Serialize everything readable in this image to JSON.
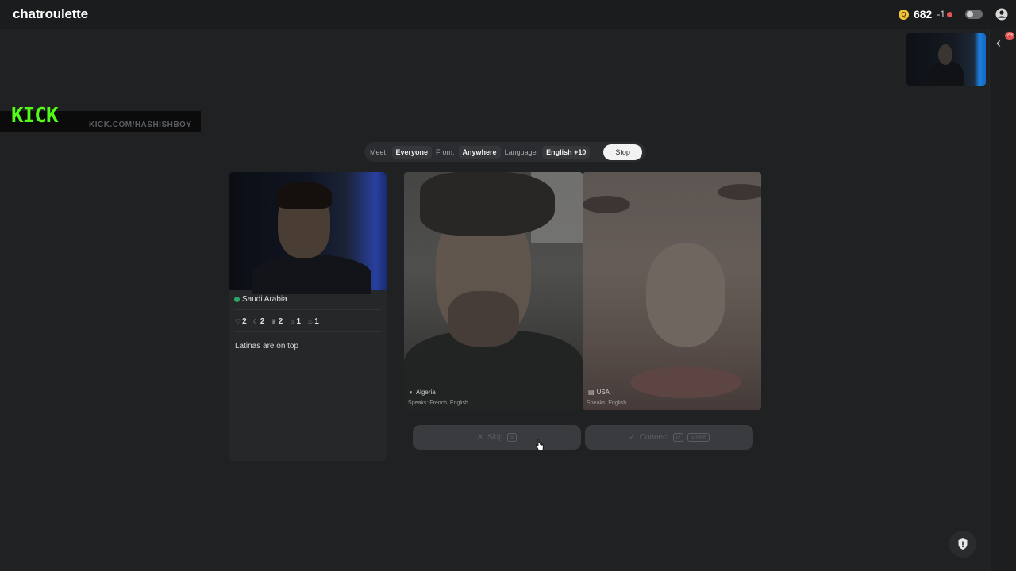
{
  "header": {
    "brand": "chatroulette",
    "coin_symbol": "Q",
    "coins": "682",
    "coin_delta": "-1"
  },
  "overlay": {
    "kick_logo": "KICK",
    "kick_url": "KICK.COM/HASHISHBOY"
  },
  "filters": {
    "meet_label": "Meet:",
    "meet_value": "Everyone",
    "from_label": "From:",
    "from_value": "Anywhere",
    "language_label": "Language:",
    "language_value": "English +10",
    "stop_label": "Stop"
  },
  "profile": {
    "country": "Saudi Arabia",
    "stats": [
      "2",
      "2",
      "2",
      "1",
      "1"
    ],
    "bio": "Latinas are on top"
  },
  "candidates": [
    {
      "country": "Algeria",
      "speaks": "Speaks: French, English"
    },
    {
      "country": "USA",
      "speaks": "Speaks: English"
    }
  ],
  "actions": {
    "skip_label": "Skip",
    "skip_key": "S",
    "connect_label": "Connect",
    "connect_key": "D",
    "connect_key2": "Space"
  },
  "rail": {
    "badge": "28"
  },
  "colors": {
    "background": "#202123",
    "accent_kick": "#53fc18",
    "coin": "#f0c43a",
    "alert": "#e25555",
    "online": "#2fa36b"
  }
}
